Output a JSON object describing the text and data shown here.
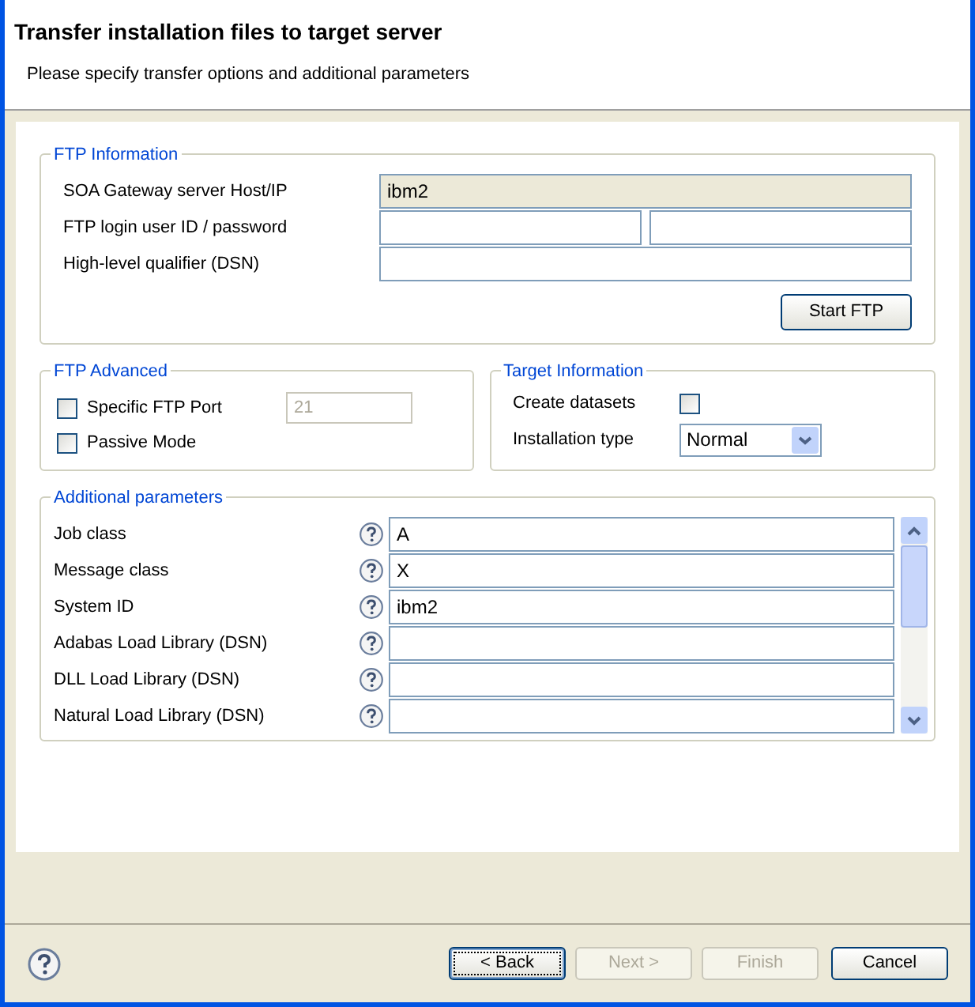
{
  "header": {
    "title": "Transfer installation files to target server",
    "subtitle": "Please specify transfer options and additional parameters"
  },
  "ftp_information": {
    "legend": "FTP Information",
    "host": {
      "label": "SOA Gateway server Host/IP",
      "value": "ibm2",
      "disabled": true
    },
    "login": {
      "label": "FTP login user ID / password"
    },
    "hlq": {
      "label": "High-level qualifier (DSN)"
    },
    "start_button": "Start FTP"
  },
  "ftp_advanced": {
    "legend": "FTP Advanced",
    "specific_port": {
      "label": "Specific FTP Port",
      "checked": false
    },
    "port_field": {
      "value": "21",
      "disabled": true
    },
    "passive_mode": {
      "label": "Passive Mode",
      "checked": false
    }
  },
  "target_information": {
    "legend": "Target Information",
    "create_datasets": {
      "label": "Create datasets",
      "checked": false
    },
    "installation_type": {
      "label": "Installation type",
      "value": "Normal"
    }
  },
  "additional_parameters": {
    "legend": "Additional parameters",
    "rows": [
      {
        "label": "Job class",
        "value": "A"
      },
      {
        "label": "Message class",
        "value": "X"
      },
      {
        "label": "System ID",
        "value": "ibm2"
      },
      {
        "label": "Adabas Load Library (DSN)"
      },
      {
        "label": "DLL Load Library (DSN)"
      },
      {
        "label": "Natural Load Library (DSN)"
      }
    ]
  },
  "buttons": [
    {
      "label": "< Back",
      "disabled": false,
      "default": true
    },
    {
      "label": "Next >",
      "disabled": true,
      "default": false
    },
    {
      "label": "Finish",
      "disabled": true,
      "default": false
    },
    {
      "label": "Cancel",
      "disabled": false,
      "default": false
    }
  ]
}
